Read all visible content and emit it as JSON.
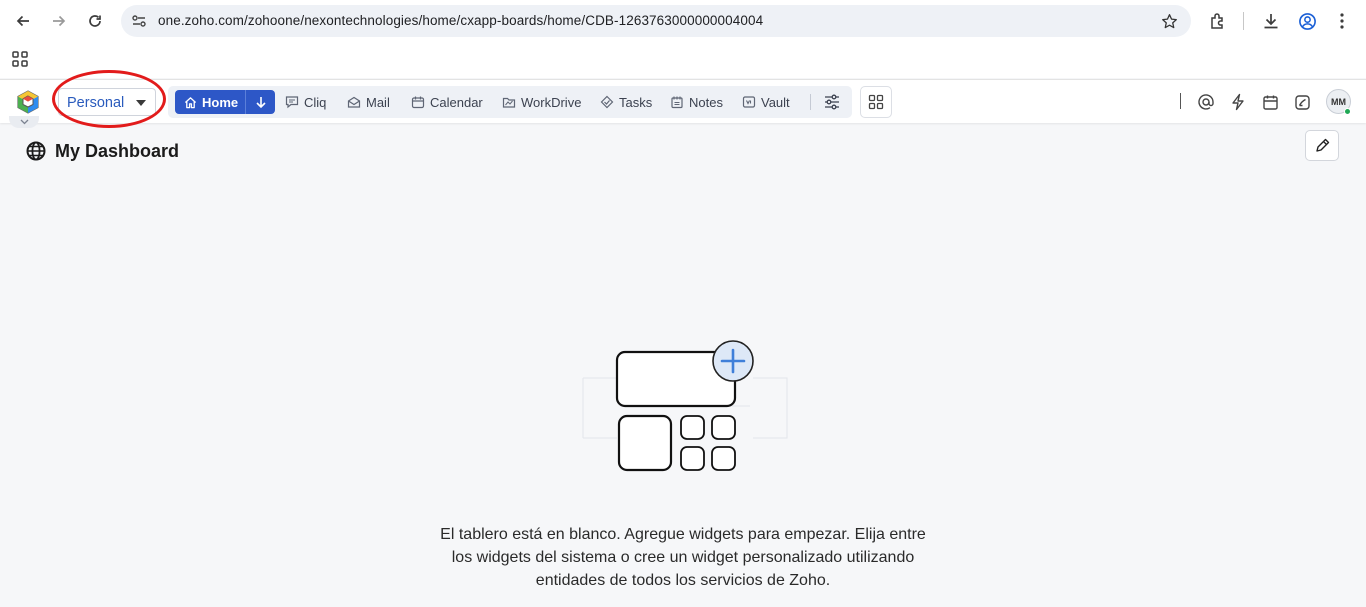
{
  "browser": {
    "url": "one.zoho.com/zohoone/nexontechnologies/home/cxapp-boards/home/CDB-1263763000000004004"
  },
  "header": {
    "workspace_dropdown": "Personal",
    "apps": [
      {
        "label": "Home",
        "icon": "home-icon"
      },
      {
        "label": "Cliq",
        "icon": "chat-icon"
      },
      {
        "label": "Mail",
        "icon": "mail-icon"
      },
      {
        "label": "Calendar",
        "icon": "calendar-icon"
      },
      {
        "label": "WorkDrive",
        "icon": "folder-icon"
      },
      {
        "label": "Tasks",
        "icon": "tasks-icon"
      },
      {
        "label": "Notes",
        "icon": "notes-icon"
      },
      {
        "label": "Vault",
        "icon": "vault-icon"
      }
    ],
    "avatar_initials": "MM"
  },
  "dashboard": {
    "title": "My Dashboard",
    "empty_message": "El tablero está en blanco. Agregue widgets para empezar. Elija entre los widgets del sistema o cree un widget personalizado utilizando entidades de todos los servicios de Zoho."
  },
  "colors": {
    "accent": "#2d57c7",
    "annotation": "#e21b1b",
    "status_online": "#1fa855"
  }
}
